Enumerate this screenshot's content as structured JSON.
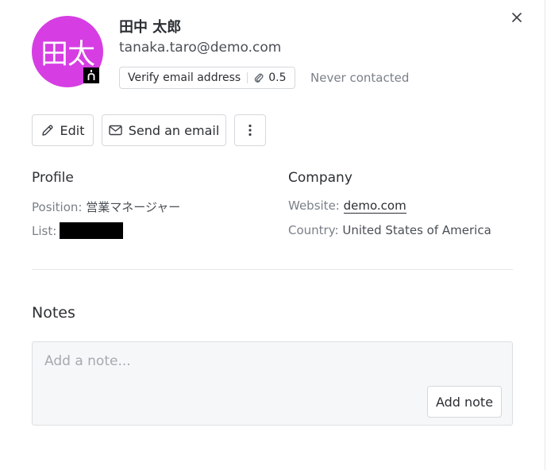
{
  "contact": {
    "avatar_initials": "田太",
    "avatar_color": "#d63ee3",
    "name": "田中 太郎",
    "email": "tanaka.taro@demo.com",
    "verify_label": "Verify email address",
    "verify_cost": "0.5",
    "contact_status": "Never contacted"
  },
  "actions": {
    "edit_label": "Edit",
    "send_email_label": "Send an email"
  },
  "profile": {
    "title": "Profile",
    "position_label": "Position:",
    "position_value": "営業マネージャー",
    "list_label": "List:"
  },
  "company": {
    "title": "Company",
    "website_label": "Website:",
    "website_value": "demo.com",
    "country_label": "Country:",
    "country_value": "United States of America"
  },
  "notes": {
    "title": "Notes",
    "placeholder": "Add a note...",
    "add_label": "Add note"
  },
  "icons": [
    "close-icon",
    "linkedin-icon",
    "pencil-icon",
    "envelope-icon",
    "paperclip-icon",
    "kebab-menu-icon"
  ]
}
